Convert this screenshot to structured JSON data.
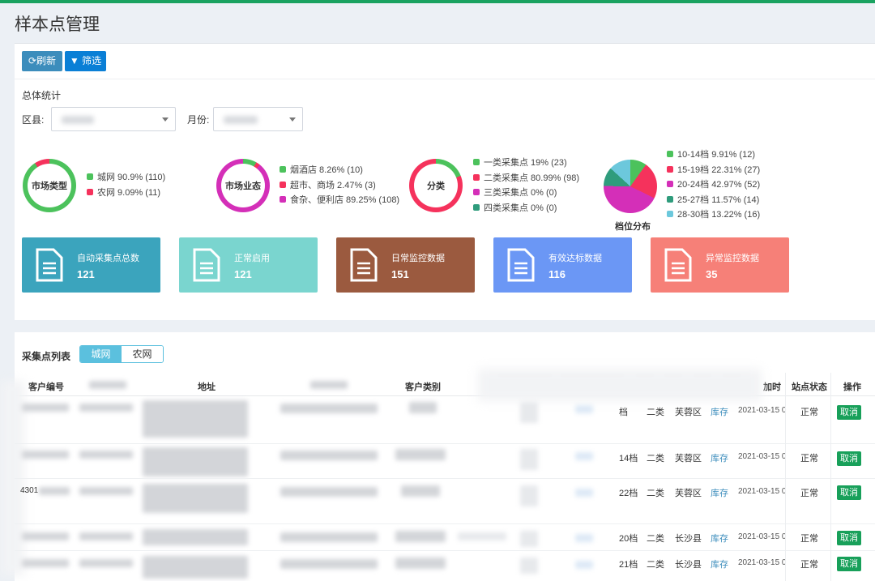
{
  "page": {
    "title": "样本点管理"
  },
  "toolbar": {
    "refresh_label": "刷新",
    "filter_label": "筛选"
  },
  "summary": {
    "heading": "总体统计",
    "district_label": "区县:",
    "month_label": "月份:"
  },
  "charts": {
    "market_type": {
      "center": "市场类型",
      "legend": [
        {
          "text": "城网 90.9% (110)",
          "color": "#4cc25c"
        },
        {
          "text": "农网 9.09% (11)",
          "color": "#f5325c"
        }
      ]
    },
    "market_business": {
      "center": "市场业态",
      "legend": [
        {
          "text": "烟酒店 8.26% (10)",
          "color": "#4cc25c"
        },
        {
          "text": "超市、商场 2.47% (3)",
          "color": "#f5325c"
        },
        {
          "text": "食杂、便利店 89.25% (108)",
          "color": "#d42fb8"
        }
      ]
    },
    "category": {
      "center": "分类",
      "legend": [
        {
          "text": "一类采集点 19% (23)",
          "color": "#4cc25c"
        },
        {
          "text": "二类采集点 80.99% (98)",
          "color": "#f5325c"
        },
        {
          "text": "三类采集点 0% (0)",
          "color": "#d42fb8"
        },
        {
          "text": "四类采集点 0% (0)",
          "color": "#2f9c7c"
        }
      ]
    },
    "grade": {
      "title": "档位分布",
      "legend": [
        {
          "text": "10-14档 9.91% (12)",
          "color": "#4cc25c"
        },
        {
          "text": "15-19档 22.31% (27)",
          "color": "#f5325c"
        },
        {
          "text": "20-24档 42.97% (52)",
          "color": "#d42fb8"
        },
        {
          "text": "25-27档 11.57% (14)",
          "color": "#2f9c7c"
        },
        {
          "text": "28-30档 13.22% (16)",
          "color": "#6cc8dc"
        }
      ]
    }
  },
  "cards": [
    {
      "title": "自动采集点总数",
      "value": "121",
      "color": "#3ba4bd"
    },
    {
      "title": "正常启用",
      "value": "121",
      "color": "#7ad5cf"
    },
    {
      "title": "日常监控数据",
      "value": "151",
      "color": "#9b5a3f"
    },
    {
      "title": "有效达标数据",
      "value": "116",
      "color": "#6b97f5"
    },
    {
      "title": "异常监控数据",
      "value": "35",
      "color": "#f68078"
    }
  ],
  "list": {
    "label": "采集点列表",
    "tabs": [
      "城网",
      "农网"
    ],
    "active_tab": "城网",
    "headers": {
      "customer_no": "客户编号",
      "address": "地址",
      "customer_type": "客户类别",
      "add_time_partial": "加时",
      "status": "站点状态",
      "action": "操作"
    },
    "rows": [
      {
        "grade": "档",
        "class": "二类",
        "district": "芙蓉区",
        "stock": "库存",
        "date": "2021-03-15 0",
        "status": "正常",
        "action": "取消"
      },
      {
        "grade": "14档",
        "class": "二类",
        "district": "芙蓉区",
        "stock": "库存",
        "date": "2021-03-15 0",
        "status": "正常",
        "action": "取消"
      },
      {
        "id_prefix": "4301",
        "grade": "22档",
        "class": "二类",
        "district": "芙蓉区",
        "stock": "库存",
        "date": "2021-03-15 0",
        "status": "正常",
        "action": "取消"
      },
      {
        "grade": "20档",
        "class": "二类",
        "district": "长沙县",
        "stock": "库存",
        "date": "2021-03-15 0",
        "status": "正常",
        "action": "取消"
      },
      {
        "grade": "21档",
        "class": "二类",
        "district": "长沙县",
        "stock": "库存",
        "date": "2021-03-15 0",
        "status": "正常",
        "action": "取消"
      }
    ]
  }
}
